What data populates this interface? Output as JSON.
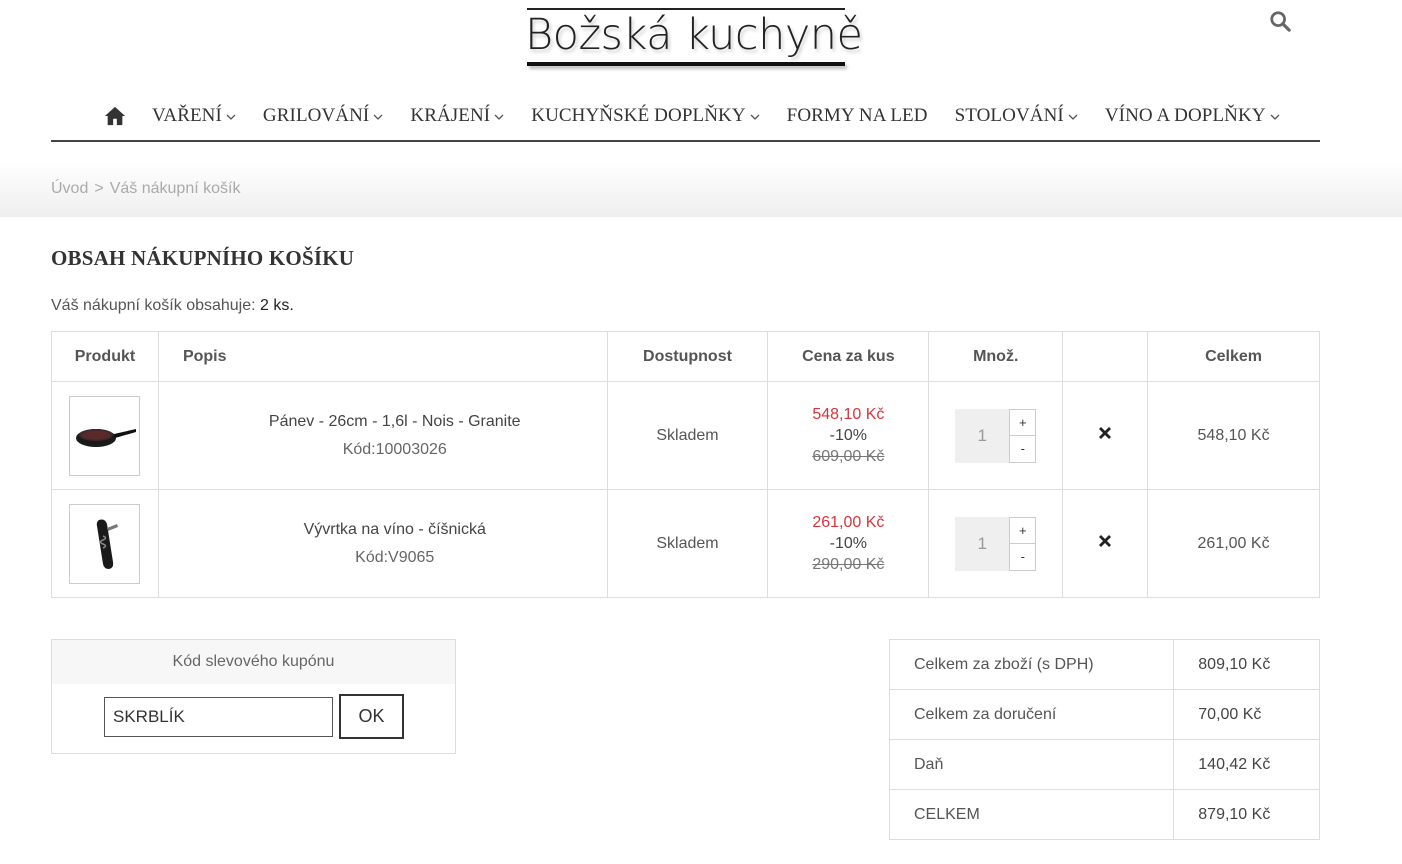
{
  "logo": {
    "text": "Božská kuchyně"
  },
  "nav": {
    "items": [
      {
        "label": "VAŘENÍ",
        "dropdown": true
      },
      {
        "label": "GRILOVÁNÍ",
        "dropdown": true
      },
      {
        "label": "KRÁJENÍ",
        "dropdown": true
      },
      {
        "label": "KUCHYŇSKÉ DOPLŇKY",
        "dropdown": true
      },
      {
        "label": "FORMY NA LED",
        "dropdown": false
      },
      {
        "label": "STOLOVÁNÍ",
        "dropdown": true
      },
      {
        "label": "VÍNO A DOPLŇKY",
        "dropdown": true
      }
    ]
  },
  "breadcrumb": {
    "home": "Úvod",
    "separator": ">",
    "current": "Váš nákupní košík"
  },
  "page": {
    "title": "OBSAH NÁKUPNÍHO KOŠÍKU",
    "count_label": "Váš nákupní košík obsahuje:",
    "count_value": "2 ks."
  },
  "cart": {
    "headers": {
      "product": "Produkt",
      "description": "Popis",
      "availability": "Dostupnost",
      "unit_price": "Cena za kus",
      "qty": "Množ.",
      "remove": "",
      "total": "Celkem"
    },
    "rows": [
      {
        "name": "Pánev - 26cm - 1,6l - Nois - Granite",
        "code": "Kód:10003026",
        "availability": "Skladem",
        "price_new": "548,10 Kč",
        "discount": "-10%",
        "price_old": "609,00 Kč",
        "qty": "1",
        "plus": "+",
        "minus": "-",
        "total": "548,10 Kč",
        "image": "pan-icon"
      },
      {
        "name": "Vývrtka na víno - číšnická",
        "code": "Kód:V9065",
        "availability": "Skladem",
        "price_new": "261,00 Kč",
        "discount": "-10%",
        "price_old": "290,00 Kč",
        "qty": "1",
        "plus": "+",
        "minus": "-",
        "total": "261,00 Kč",
        "image": "corkscrew-icon"
      }
    ]
  },
  "coupon": {
    "header": "Kód slevového kupónu",
    "value": "SKRBLÍK",
    "button": "OK"
  },
  "totals": [
    {
      "label": "Celkem za zboží (s DPH)",
      "value": "809,10 Kč"
    },
    {
      "label": "Celkem za doručení",
      "value": "70,00 Kč"
    },
    {
      "label": "Daň",
      "value": "140,42 Kč"
    },
    {
      "label": "CELKEM",
      "value": "879,10 Kč"
    }
  ],
  "colors": {
    "discount_price": "#d9343a",
    "nav_border": "#444444"
  }
}
